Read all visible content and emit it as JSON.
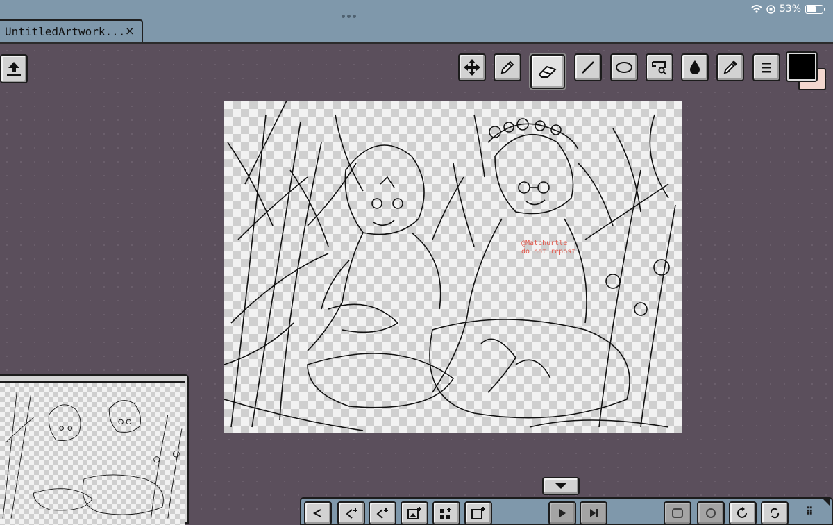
{
  "status_bar": {
    "battery": "53%",
    "battery_level": 0.53
  },
  "tab": {
    "title": "UntitledArtwork...",
    "close_label": "×"
  },
  "toolbar": {
    "tools": [
      "move-icon",
      "pencil-icon",
      "eraser-icon",
      "line-icon",
      "ellipse-icon",
      "lasso-icon",
      "fill-icon",
      "eyedropper-icon",
      "menu-icon"
    ],
    "active_tool": "eraser-icon",
    "primary_color": "#000000",
    "secondary_color": "#f3d7cf"
  },
  "canvas": {
    "watermark_line1": "@Matchurtle",
    "watermark_line2": "do not repost"
  },
  "timeline": {
    "buttons": [
      "undo-icon",
      "add-frame-icon",
      "duplicate-frame-icon",
      "insert-image-icon",
      "grid-add-icon",
      "new-frame-icon",
      "play-icon",
      "step-icon",
      "onion-skin-icon",
      "loop-icon",
      "redo-icon",
      "sync-icon"
    ],
    "grip": "⠿"
  },
  "colors": {
    "accent": "#7f98ab",
    "background": "#5b4f5c"
  }
}
